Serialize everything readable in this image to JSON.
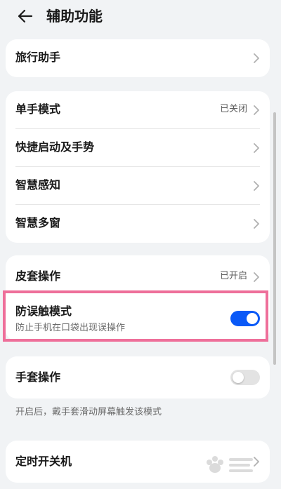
{
  "header": {
    "title": "辅助功能",
    "back_icon": "arrow-left-icon"
  },
  "group1": {
    "items": [
      {
        "label": "旅行助手"
      }
    ]
  },
  "group2": {
    "items": [
      {
        "label": "单手模式",
        "value": "已关闭"
      },
      {
        "label": "快捷启动及手势"
      },
      {
        "label": "智慧感知"
      },
      {
        "label": "智慧多窗"
      }
    ]
  },
  "group3": {
    "items": [
      {
        "label": "皮套操作",
        "value": "已开启"
      },
      {
        "label": "防误触模式",
        "subtitle": "防止手机在口袋出现误操作",
        "toggle": "on"
      }
    ]
  },
  "group4": {
    "items": [
      {
        "label": "手套操作",
        "toggle": "off"
      }
    ],
    "note": "开启后，戴手套滑动屏幕触发该模式"
  },
  "group5": {
    "items": [
      {
        "label": "定时开关机"
      }
    ]
  },
  "colors": {
    "accent": "#0a59f7",
    "highlight": "#ee6f9a",
    "background": "#f1f3f5"
  }
}
